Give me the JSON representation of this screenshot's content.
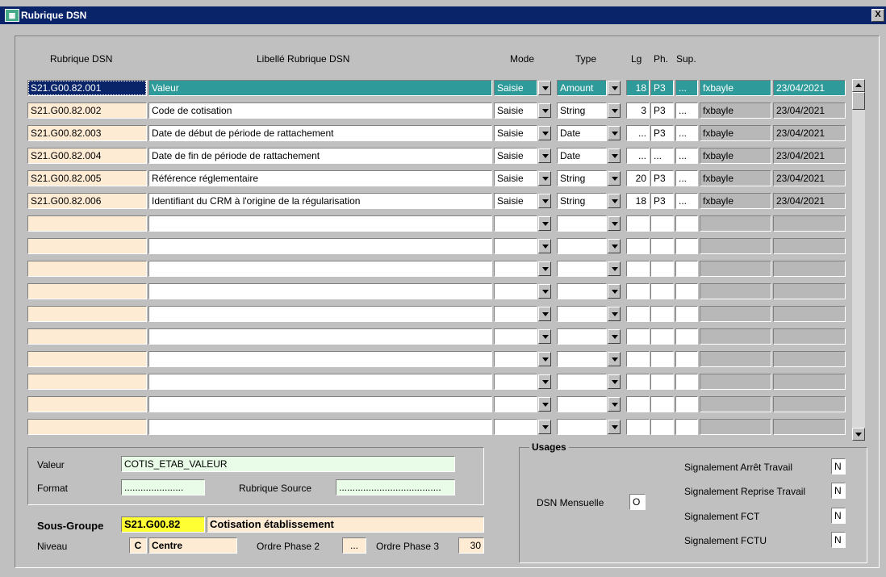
{
  "window": {
    "title": "Rubrique DSN",
    "close_label": "X"
  },
  "columns": {
    "rubrique": "Rubrique DSN",
    "libelle": "Libellé Rubrique DSN",
    "mode": "Mode",
    "type": "Type",
    "lg": "Lg",
    "ph": "Ph.",
    "sup": "Sup."
  },
  "rows": [
    {
      "rubrique": "S21.G00.82.001",
      "libelle": "Valeur",
      "mode": "Saisie",
      "type": "Amount",
      "lg": "18",
      "ph": "P3",
      "sup": "...",
      "user": "fxbayle",
      "date": "23/04/2021"
    },
    {
      "rubrique": "S21.G00.82.002",
      "libelle": "Code de cotisation",
      "mode": "Saisie",
      "type": "String",
      "lg": "3",
      "ph": "P3",
      "sup": "...",
      "user": "fxbayle",
      "date": "23/04/2021"
    },
    {
      "rubrique": "S21.G00.82.003",
      "libelle": "Date de début de période de rattachement",
      "mode": "Saisie",
      "type": "Date",
      "lg": "...",
      "ph": "P3",
      "sup": "...",
      "user": "fxbayle",
      "date": "23/04/2021"
    },
    {
      "rubrique": "S21.G00.82.004",
      "libelle": "Date de fin de période de rattachement",
      "mode": "Saisie",
      "type": "Date",
      "lg": "...",
      "ph": "...",
      "sup": "...",
      "user": "fxbayle",
      "date": "23/04/2021"
    },
    {
      "rubrique": "S21.G00.82.005",
      "libelle": "Référence réglementaire",
      "mode": "Saisie",
      "type": "String",
      "lg": "20",
      "ph": "P3",
      "sup": "...",
      "user": "fxbayle",
      "date": "23/04/2021"
    },
    {
      "rubrique": "S21.G00.82.006",
      "libelle": "Identifiant du CRM à l'origine de la régularisation",
      "mode": "Saisie",
      "type": "String",
      "lg": "18",
      "ph": "P3",
      "sup": "...",
      "user": "fxbayle",
      "date": "23/04/2021"
    },
    {
      "rubrique": "",
      "libelle": "",
      "mode": "",
      "type": "",
      "lg": "",
      "ph": "",
      "sup": "",
      "user": "",
      "date": ""
    },
    {
      "rubrique": "",
      "libelle": "",
      "mode": "",
      "type": "",
      "lg": "",
      "ph": "",
      "sup": "",
      "user": "",
      "date": ""
    },
    {
      "rubrique": "",
      "libelle": "",
      "mode": "",
      "type": "",
      "lg": "",
      "ph": "",
      "sup": "",
      "user": "",
      "date": ""
    },
    {
      "rubrique": "",
      "libelle": "",
      "mode": "",
      "type": "",
      "lg": "",
      "ph": "",
      "sup": "",
      "user": "",
      "date": ""
    },
    {
      "rubrique": "",
      "libelle": "",
      "mode": "",
      "type": "",
      "lg": "",
      "ph": "",
      "sup": "",
      "user": "",
      "date": ""
    },
    {
      "rubrique": "",
      "libelle": "",
      "mode": "",
      "type": "",
      "lg": "",
      "ph": "",
      "sup": "",
      "user": "",
      "date": ""
    },
    {
      "rubrique": "",
      "libelle": "",
      "mode": "",
      "type": "",
      "lg": "",
      "ph": "",
      "sup": "",
      "user": "",
      "date": ""
    },
    {
      "rubrique": "",
      "libelle": "",
      "mode": "",
      "type": "",
      "lg": "",
      "ph": "",
      "sup": "",
      "user": "",
      "date": ""
    },
    {
      "rubrique": "",
      "libelle": "",
      "mode": "",
      "type": "",
      "lg": "",
      "ph": "",
      "sup": "",
      "user": "",
      "date": ""
    },
    {
      "rubrique": "",
      "libelle": "",
      "mode": "",
      "type": "",
      "lg": "",
      "ph": "",
      "sup": "",
      "user": "",
      "date": ""
    }
  ],
  "detail": {
    "valeur_label": "Valeur",
    "valeur_value": "COTIS_ETAB_VALEUR",
    "format_label": "Format",
    "format_value": "......................",
    "source_label": "Rubrique Source",
    "source_value": "......................................"
  },
  "sousgroupe": {
    "label": "Sous-Groupe",
    "code": "S21.G00.82",
    "name": "Cotisation établissement",
    "niveau_label": "Niveau",
    "niveau_code": "C",
    "niveau_name": "Centre",
    "ordre2_label": "Ordre Phase 2",
    "ordre2_value": "...",
    "ordre3_label": "Ordre Phase 3",
    "ordre3_value": "30"
  },
  "usages": {
    "title": "Usages",
    "dsn_label": "DSN Mensuelle",
    "dsn_value": "O",
    "arret_label": "Signalement Arrêt Travail",
    "arret_value": "N",
    "reprise_label": "Signalement Reprise Travail",
    "reprise_value": "N",
    "fct_label": "Signalement FCT",
    "fct_value": "N",
    "fctu_label": "Signalement FCTU",
    "fctu_value": "N"
  }
}
